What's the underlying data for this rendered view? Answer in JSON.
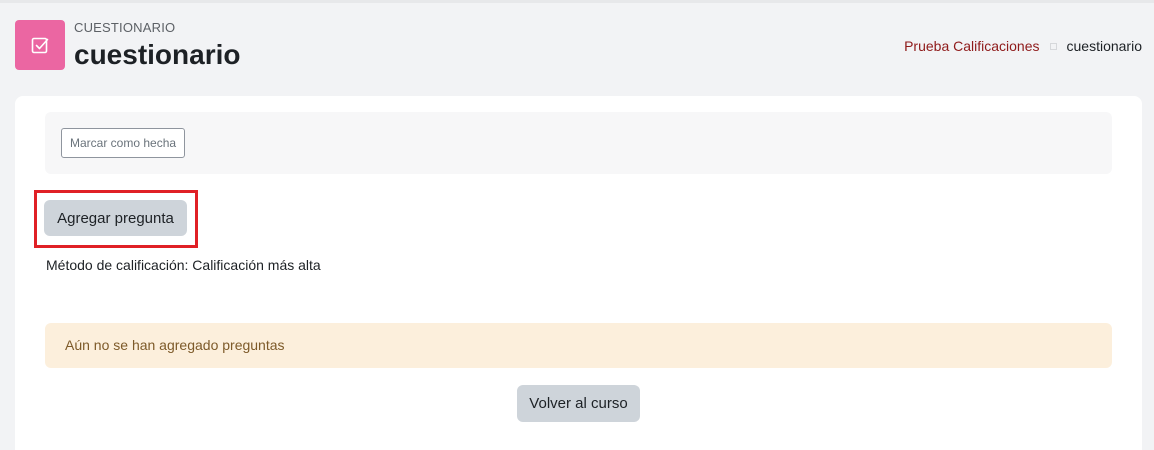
{
  "header": {
    "module_name": "CUESTIONARIO",
    "title": "cuestionario",
    "icon": "quiz-checkbox-icon",
    "icon_color": "#eb66a2"
  },
  "breadcrumb": {
    "items": [
      {
        "label": "Prueba Calificaciones"
      },
      {
        "label": "cuestionario"
      }
    ],
    "link_color": "#8f1a1a"
  },
  "completion": {
    "mark_done_label": "Marcar como hecha"
  },
  "actions": {
    "add_question_label": "Agregar pregunta",
    "highlight_color": "#e02026"
  },
  "grading": {
    "text": "Método de calificación: Calificación más alta"
  },
  "alert": {
    "text": "Aún no se han agregado preguntas",
    "background": "#fcefdc"
  },
  "footer": {
    "back_label": "Volver al curso"
  }
}
